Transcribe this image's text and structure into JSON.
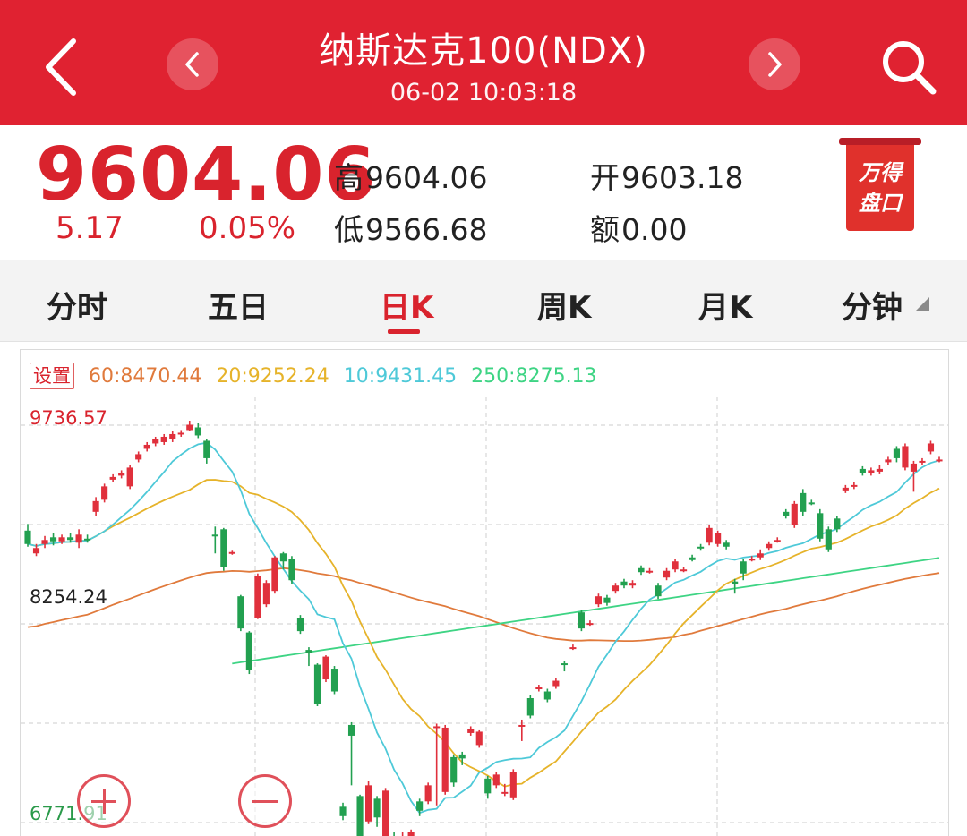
{
  "header": {
    "title": "纳斯达克100(NDX)",
    "time": "06-02 10:03:18",
    "bg_color": "#e02231",
    "icons": [
      "back-icon",
      "chevron-left-icon",
      "chevron-right-icon",
      "search-icon"
    ]
  },
  "quote": {
    "price": "9604.06",
    "change": "5.17",
    "change_pct": "0.05%",
    "stats": [
      {
        "label": "高",
        "value": "9604.06"
      },
      {
        "label": "低",
        "value": "9566.68"
      },
      {
        "label": "开",
        "value": "9603.18"
      },
      {
        "label": "额",
        "value": "0.00"
      }
    ],
    "badge": {
      "line1": "万得",
      "line2": "盘口"
    },
    "up_color": "#d9232d"
  },
  "tabs": {
    "items": [
      "分时",
      "五日",
      "日K",
      "周K",
      "月K",
      "分钟"
    ],
    "active_index": 2
  },
  "chart": {
    "settings_label": "设置",
    "ma": [
      {
        "label": "60:8470.44",
        "color": "#e07a3c"
      },
      {
        "label": "20:9252.24",
        "color": "#e6b32a"
      },
      {
        "label": "10:9431.45",
        "color": "#4ec9d8"
      },
      {
        "label": "250:8275.13",
        "color": "#3ed484"
      }
    ],
    "y_labels": [
      {
        "text": "9736.57",
        "color": "#d9232d"
      },
      {
        "text": "8254.24",
        "color": "#222222"
      },
      {
        "text": "6771.91",
        "color": "#2a9a4a"
      }
    ],
    "zoom": {
      "in": "zoom-in-icon",
      "out": "zoom-out-icon"
    }
  },
  "chart_data": {
    "type": "candlestick",
    "y_axis_labels": [
      9736.57,
      8254.24,
      6771.91
    ],
    "ylim": [
      6771.91,
      9736.57
    ],
    "grid": true,
    "up_color": "#e0303c",
    "down_color": "#22a050",
    "candles": [
      [
        8950,
        8850,
        9000,
        8830
      ],
      [
        8780,
        8820,
        8850,
        8760
      ],
      [
        8850,
        8880,
        8910,
        8820
      ],
      [
        8900,
        8870,
        8930,
        8840
      ],
      [
        8870,
        8900,
        8920,
        8850
      ],
      [
        8900,
        8880,
        8930,
        8860
      ],
      [
        8860,
        8920,
        8960,
        8820
      ],
      [
        8890,
        8880,
        8920,
        8860
      ],
      [
        9090,
        9170,
        9200,
        9060
      ],
      [
        9180,
        9280,
        9300,
        9160
      ],
      [
        9330,
        9350,
        9370,
        9310
      ],
      [
        9360,
        9380,
        9400,
        9340
      ],
      [
        9280,
        9420,
        9440,
        9260
      ],
      [
        9480,
        9520,
        9540,
        9460
      ],
      [
        9560,
        9590,
        9610,
        9540
      ],
      [
        9600,
        9630,
        9650,
        9580
      ],
      [
        9610,
        9650,
        9670,
        9590
      ],
      [
        9630,
        9670,
        9690,
        9610
      ],
      [
        9670,
        9680,
        9700,
        9650
      ],
      [
        9700,
        9740,
        9770,
        9690
      ],
      [
        9720,
        9660,
        9750,
        9640
      ],
      [
        9620,
        9490,
        9630,
        9450
      ],
      [
        8920,
        8910,
        8980,
        8780
      ],
      [
        8960,
        8680,
        8970,
        8650
      ],
      [
        8780,
        8790,
        8800,
        8770
      ],
      [
        8460,
        8220,
        8470,
        8200
      ],
      [
        8190,
        7910,
        8200,
        7880
      ],
      [
        8300,
        8610,
        8630,
        8290
      ],
      [
        8400,
        8560,
        8580,
        8380
      ],
      [
        8500,
        8750,
        8760,
        8480
      ],
      [
        8780,
        8720,
        8790,
        8660
      ],
      [
        8740,
        8580,
        8760,
        8550
      ],
      [
        8300,
        8200,
        8320,
        8180
      ],
      [
        8060,
        8040,
        8080,
        7940
      ],
      [
        7950,
        7660,
        7960,
        7640
      ],
      [
        7840,
        8010,
        8020,
        7820
      ],
      [
        7920,
        7750,
        7940,
        7730
      ],
      [
        6890,
        6820,
        6920,
        6790
      ],
      [
        7500,
        7420,
        7520,
        7050
      ],
      [
        6970,
        6660,
        6980,
        6610
      ],
      [
        6780,
        7050,
        7080,
        6760
      ],
      [
        6950,
        6810,
        6970,
        6740
      ],
      [
        6540,
        7010,
        7030,
        6520
      ],
      [
        6600,
        6480,
        6700,
        6440
      ],
      [
        6520,
        6630,
        6700,
        6440
      ],
      [
        6510,
        6700,
        6720,
        6350
      ],
      [
        6930,
        6860,
        6950,
        6820
      ],
      [
        6930,
        7050,
        7070,
        6910
      ],
      [
        7490,
        7490,
        7510,
        6900
      ],
      [
        7000,
        7480,
        7500,
        6980
      ],
      [
        7260,
        7070,
        7280,
        7040
      ],
      [
        7280,
        7250,
        7300,
        7200
      ],
      [
        7440,
        7470,
        7490,
        7420
      ],
      [
        7350,
        7450,
        7460,
        7330
      ],
      [
        7100,
        6990,
        7120,
        6950
      ],
      [
        7050,
        7130,
        7150,
        7030
      ],
      [
        6990,
        7000,
        7060,
        6970
      ],
      [
        6960,
        7150,
        7170,
        6940
      ],
      [
        7500,
        7500,
        7540,
        7380
      ],
      [
        7700,
        7570,
        7720,
        7550
      ],
      [
        7770,
        7780,
        7800,
        7750
      ],
      [
        7750,
        7690,
        7770,
        7670
      ],
      [
        7790,
        7830,
        7850,
        7770
      ],
      [
        7960,
        7950,
        7980,
        7900
      ],
      [
        8080,
        8080,
        8100,
        8060
      ],
      [
        8340,
        8220,
        8360,
        8200
      ],
      [
        8260,
        8260,
        8280,
        8240
      ],
      [
        8400,
        8460,
        8480,
        8380
      ],
      [
        8450,
        8410,
        8470,
        8390
      ],
      [
        8500,
        8540,
        8560,
        8480
      ],
      [
        8570,
        8540,
        8590,
        8520
      ],
      [
        8540,
        8560,
        8580,
        8520
      ],
      [
        8670,
        8640,
        8690,
        8620
      ],
      [
        8650,
        8650,
        8670,
        8630
      ],
      [
        8540,
        8460,
        8560,
        8440
      ],
      [
        8600,
        8650,
        8670,
        8580
      ],
      [
        8660,
        8720,
        8740,
        8640
      ],
      [
        8660,
        8660,
        8680,
        8640
      ],
      [
        8750,
        8730,
        8770,
        8720
      ],
      [
        8830,
        8820,
        8850,
        8800
      ],
      [
        8860,
        8970,
        8990,
        8840
      ],
      [
        8850,
        8930,
        8950,
        8830
      ],
      [
        8860,
        8830,
        8880,
        8810
      ],
      [
        8570,
        8550,
        8590,
        8480
      ],
      [
        8720,
        8630,
        8740,
        8580
      ],
      [
        8740,
        8740,
        8760,
        8720
      ],
      [
        8750,
        8780,
        8810,
        8730
      ],
      [
        8820,
        8850,
        8870,
        8800
      ],
      [
        8880,
        8880,
        8900,
        8860
      ],
      [
        9090,
        9060,
        9110,
        9040
      ],
      [
        8990,
        9150,
        9170,
        8970
      ],
      [
        9230,
        9090,
        9260,
        9060
      ],
      [
        9160,
        9150,
        9180,
        9140
      ],
      [
        9080,
        8890,
        9110,
        8870
      ],
      [
        8960,
        8810,
        8980,
        8790
      ],
      [
        9040,
        8960,
        9060,
        8940
      ],
      [
        9250,
        9270,
        9290,
        9230
      ],
      [
        9280,
        9290,
        9310,
        9260
      ],
      [
        9410,
        9380,
        9430,
        9360
      ],
      [
        9380,
        9400,
        9420,
        9360
      ],
      [
        9390,
        9410,
        9440,
        9370
      ],
      [
        9460,
        9480,
        9500,
        9440
      ],
      [
        9560,
        9490,
        9580,
        9460
      ],
      [
        9420,
        9580,
        9600,
        9400
      ],
      [
        9390,
        9450,
        9470,
        9240
      ],
      [
        9460,
        9470,
        9490,
        9440
      ],
      [
        9540,
        9600,
        9620,
        9520
      ],
      [
        9470,
        9480,
        9500,
        9460
      ]
    ]
  }
}
